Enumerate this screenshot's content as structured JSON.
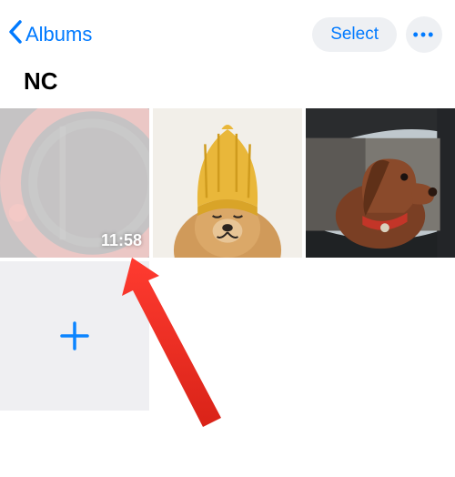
{
  "header": {
    "back_label": "Albums",
    "select_label": "Select"
  },
  "album": {
    "title": "NC"
  },
  "tiles": [
    {
      "type": "video",
      "duration": "11:58"
    },
    {
      "type": "photo"
    },
    {
      "type": "photo"
    },
    {
      "type": "add"
    }
  ],
  "icons": {
    "more": "•••"
  }
}
